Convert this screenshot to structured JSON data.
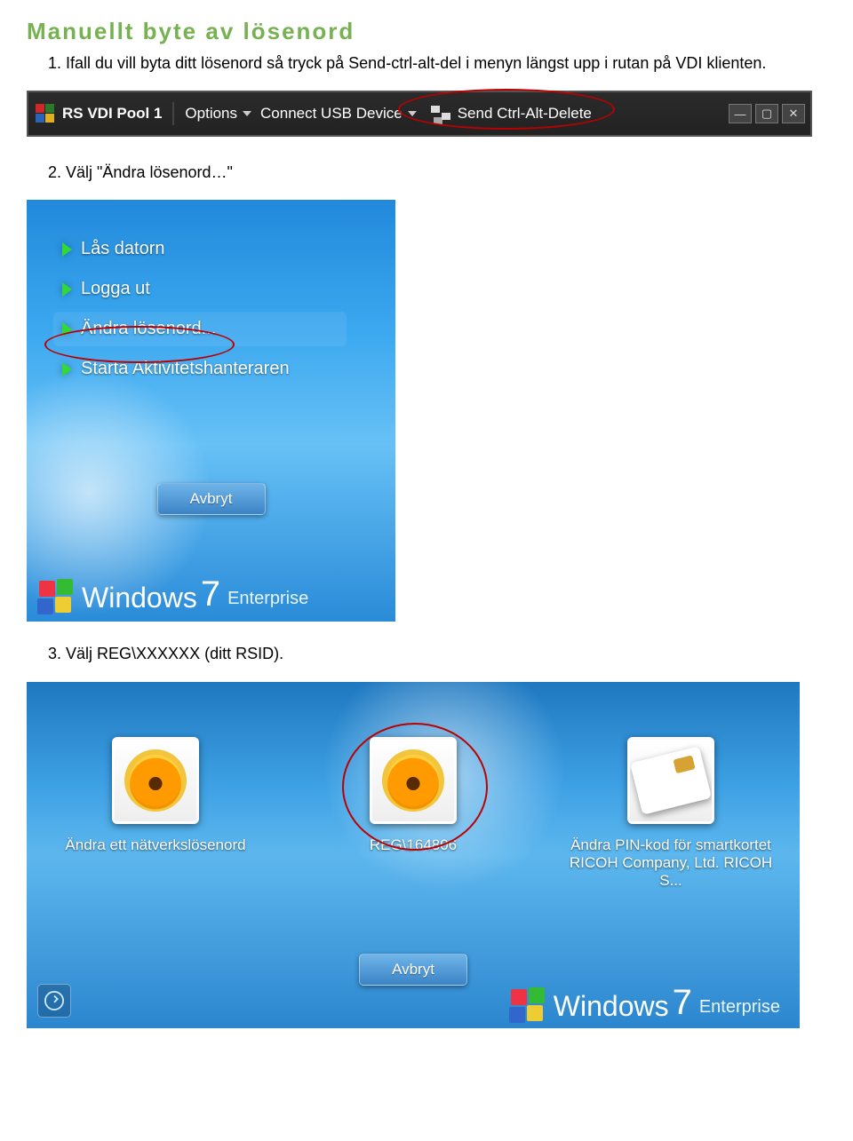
{
  "title": "Manuellt byte av lösenord",
  "steps": {
    "s1": "1.  Ifall du vill byta ditt lösenord så tryck på Send-ctrl-alt-del i menyn längst upp i rutan på VDI klienten.",
    "s2": "2.  Välj \"Ändra lösenord…\"",
    "s3": "3.  Välj REG\\XXXXXX (ditt RSID)."
  },
  "toolbar": {
    "title": "RS VDI Pool 1",
    "options": "Options",
    "usb": "Connect USB Device",
    "cad": "Send Ctrl-Alt-Delete",
    "min": "—",
    "max": "▢",
    "close": "✕"
  },
  "cad_menu": {
    "items": [
      "Lås datorn",
      "Logga ut",
      "Ändra lösenord...",
      "Starta Aktivitetshanteraren"
    ],
    "underline_index": [
      0,
      0,
      0,
      0
    ],
    "cancel": "Avbryt"
  },
  "brand": {
    "name": "Windows",
    "ver": "7",
    "edition": "Enterprise"
  },
  "login": {
    "tiles": [
      {
        "label": "Ändra ett nätverkslösenord",
        "kind": "flower"
      },
      {
        "label": "REG\\164806",
        "kind": "flower"
      },
      {
        "label": "Ändra PIN-kod för smartkortet RICOH Company, Ltd. RICOH S...",
        "kind": "card"
      }
    ],
    "cancel": "Avbryt"
  }
}
